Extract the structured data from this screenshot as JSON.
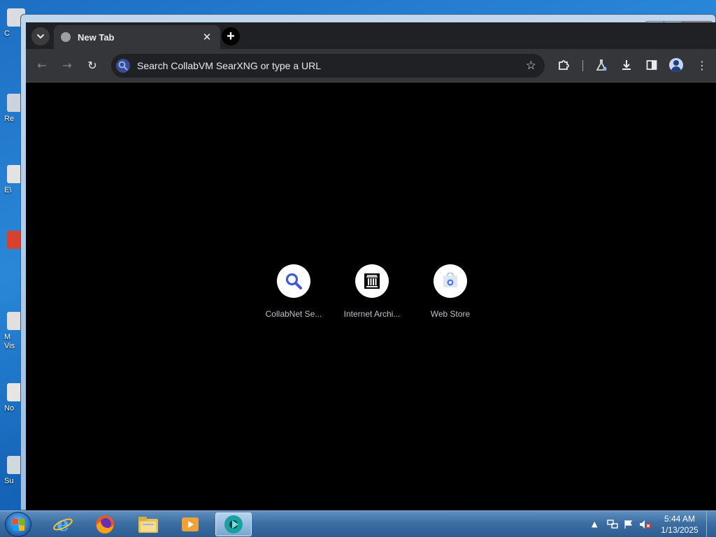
{
  "desktop": {
    "icons": [
      {
        "label": "C",
        "color": "#d9dde2"
      },
      {
        "label": "Re",
        "color": "#cbd3dc"
      },
      {
        "label": "E\\",
        "color": "#e3e3e3"
      },
      {
        "label": "",
        "color": "#d7412f"
      },
      {
        "label": "M\nVis",
        "color": "#e0e0e0"
      },
      {
        "label": "No",
        "color": "#e6e6e6"
      },
      {
        "label": "Su",
        "color": "#d0d8e0"
      }
    ]
  },
  "window": {
    "caption_buttons": {
      "minimize": "▬",
      "maximize": "▢",
      "close": "✕"
    }
  },
  "browser": {
    "tab_search_icon": "chevron-down-icon",
    "tab_title": "New Tab",
    "tab_close": "✕",
    "new_tab": "+",
    "omnibox_placeholder": "Search CollabVM SearXNG or type a URL",
    "toolbar_icons": [
      "back-icon",
      "forward-icon",
      "reload-icon",
      "star-icon",
      "extensions-icon",
      "labs-icon",
      "download-icon",
      "side-panel-icon",
      "profile-icon",
      "menu-icon"
    ],
    "shortcuts": [
      {
        "label": "CollabNet Se...",
        "icon": "search-icon"
      },
      {
        "label": "Internet Archi...",
        "icon": "archive-icon"
      },
      {
        "label": "Web Store",
        "icon": "web-store-icon"
      }
    ]
  },
  "taskbar": {
    "apps": [
      "internet-explorer-icon",
      "firefox-icon",
      "file-explorer-icon",
      "media-player-icon",
      "chrome-icon"
    ],
    "tray_icons": [
      "tray-up-arrow-icon",
      "network-icon",
      "action-center-flag-icon",
      "volume-muted-icon"
    ],
    "clock_time": "5:44 AM",
    "clock_date": "1/13/2025"
  }
}
